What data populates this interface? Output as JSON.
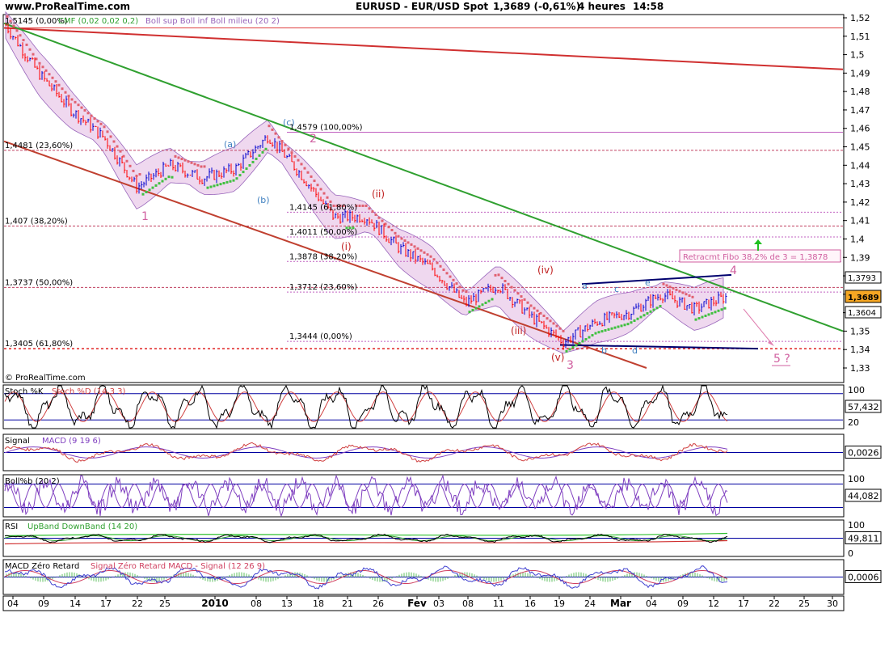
{
  "header": {
    "site": "www.ProRealTime.com",
    "title": "EURUSD - EUR/USD Spot",
    "price": "1,3689 (-0,61%)",
    "period": "4 heures",
    "time": "14:58",
    "copyright": "© ProRealTime.com"
  },
  "colors": {
    "up_candle": "#0000cc",
    "down_candle": "#ff0000",
    "bollinger_fill": "#e8c8e8",
    "bollinger_line": "#9966bb",
    "sar_red": "#e06070",
    "sar_green": "#40c040",
    "trend_green": "#30a030",
    "trend_red": "#c03030",
    "wave_pink": "#d060a0",
    "wave_blue": "#4080c0",
    "wave_red": "#c02020",
    "fib_line": "#c04060",
    "fib_line_light": "#c060c0",
    "grid_line": "#0000a0"
  },
  "main_panel": {
    "indicator_labels": {
      "legend_price": "1,5145 (0,00%)",
      "cmf": "CMF (0,02 0,02 0,2)",
      "boll": "Boll sup Boll inf Boll milieu (20 2)"
    },
    "y_ticks": [
      "1,52",
      "1,51",
      "1,5",
      "1,49",
      "1,48",
      "1,47",
      "1,46",
      "1,45",
      "1,44",
      "1,43",
      "1,42",
      "1,41",
      "1,4",
      "1,39",
      "1,38",
      "1,37",
      "1,36",
      "1,35",
      "1,34",
      "1,33"
    ],
    "y_range": [
      1.33,
      1.52
    ],
    "price_tags": [
      "1,3793",
      "1,3689",
      "1,3604"
    ],
    "fib_levels_left": [
      {
        "value": 1.4481,
        "label": "1,4481 (23,60%)"
      },
      {
        "value": 1.407,
        "label": "1,407 (38,20%)"
      },
      {
        "value": 1.3737,
        "label": "1,3737 (50,00%)"
      },
      {
        "value": 1.3405,
        "label": "1,3405 (61,80%)"
      }
    ],
    "fib_levels_right": [
      {
        "value": 1.4579,
        "label": "1,4579 (100,00%)"
      },
      {
        "value": 1.4145,
        "label": "1,4145 (61,80%)"
      },
      {
        "value": 1.4011,
        "label": "1,4011 (50,00%)"
      },
      {
        "value": 1.3878,
        "label": "1,3878 (38,20%)"
      },
      {
        "value": 1.3712,
        "label": "1,3712 (23,60%)"
      },
      {
        "value": 1.3444,
        "label": "1,3444 (0,00%)"
      }
    ],
    "annotation_box": "Retracmt Fibo 38,2% de 3 = 1,3878",
    "waves_pink": [
      "1",
      "2",
      "3",
      "4",
      "5 ?"
    ],
    "waves_blue": [
      "(a)",
      "(b)",
      "(c)",
      "a",
      "b",
      "c",
      "d",
      "e"
    ],
    "waves_red": [
      "(i)",
      "(ii)",
      "(iii)",
      "(iv)",
      "(v)"
    ]
  },
  "panels": [
    {
      "label": "Stoch %K",
      "label2": "Stoch %D (14 3 3)",
      "ticks": [
        "100",
        "20"
      ],
      "value": "57,432"
    },
    {
      "label": "Signal",
      "label2": "MACD (9 19 6)",
      "ticks": [],
      "value": "0,0026"
    },
    {
      "label": "Boll%b (20 2)",
      "label2": "",
      "ticks": [
        "100"
      ],
      "value": "44,082"
    },
    {
      "label": "RSI",
      "label2": "UpBand DownBand (14 20)",
      "ticks": [
        "100",
        "0"
      ],
      "value": "49,811"
    },
    {
      "label": "MACD Zéro Retard",
      "label2": "Signal Zéro Retard MACD - Signal (12 26 9)",
      "ticks": [],
      "value": "0,0006"
    }
  ],
  "x_axis": {
    "ticks": [
      "04",
      "09",
      "14",
      "17",
      "22",
      "25",
      "2010",
      "08",
      "13",
      "18",
      "21",
      "26",
      "Fev",
      "03",
      "08",
      "11",
      "16",
      "19",
      "24",
      "Mar",
      "04",
      "09",
      "12",
      "17",
      "22",
      "25",
      "30"
    ]
  },
  "chart_data": {
    "type": "line",
    "title": "EURUSD - EUR/USD Spot",
    "xlabel": "",
    "ylabel": "",
    "ylim": [
      1.33,
      1.52
    ],
    "x": [
      "04",
      "09",
      "14",
      "17",
      "22",
      "25",
      "2010",
      "08",
      "13",
      "18",
      "21",
      "26",
      "Fev",
      "03",
      "08",
      "11",
      "16",
      "19",
      "24",
      "Mar",
      "04",
      "09",
      "12"
    ],
    "series": [
      {
        "name": "",
        "values": [
          1.516,
          1.49,
          1.47,
          1.455,
          1.428,
          1.44,
          1.433,
          1.438,
          1.456,
          1.435,
          1.412,
          1.412,
          1.395,
          1.384,
          1.365,
          1.375,
          1.358,
          1.344,
          1.355,
          1.36,
          1.37,
          1.362,
          1.3689
        ]
      }
    ],
    "annotations": [
      "Retracmt Fibo 38,2% de 3 = 1,3878"
    ]
  }
}
